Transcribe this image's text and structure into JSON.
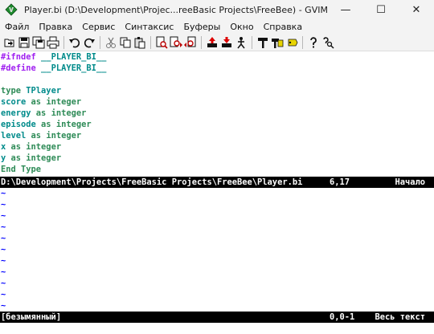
{
  "window": {
    "title": "Player.bi (D:\\Development\\Projec...reeBasic Projects\\FreeBee) - GVIM",
    "controls": {
      "minimize": "—",
      "maximize": "☐",
      "close": "✕"
    }
  },
  "menu": [
    "Файл",
    "Правка",
    "Сервис",
    "Синтаксис",
    "Буферы",
    "Окно",
    "Справка"
  ],
  "toolbar": {
    "icons": [
      "open-file-icon",
      "save-icon",
      "save-all-icon",
      "print-icon",
      "undo-icon",
      "redo-icon",
      "cut-icon",
      "copy-icon",
      "paste-icon",
      "find-replace-icon",
      "find-next-icon",
      "find-prev-icon",
      "load-session-icon",
      "save-session-icon",
      "run-script-icon",
      "make-icon",
      "run-ctags-icon",
      "jump-to-tag-icon",
      "help-icon",
      "find-help-icon"
    ]
  },
  "editor": {
    "lines": [
      [
        {
          "t": "#ifndef",
          "c": "pre"
        },
        {
          "t": " __PLAYER_BI__",
          "c": "ident"
        }
      ],
      [
        {
          "t": "#define",
          "c": "pre"
        },
        {
          "t": " __PLAYER_BI__",
          "c": "ident"
        }
      ],
      [],
      [
        {
          "t": "type",
          "c": "kw"
        },
        {
          "t": " TPlayer",
          "c": "plain"
        }
      ],
      [
        {
          "t": "score ",
          "c": "plain"
        },
        {
          "t": "as",
          "c": "kw"
        },
        {
          "t": " integer",
          "c": "type"
        }
      ],
      [
        {
          "t": "energy ",
          "c": "plain"
        },
        {
          "t": "as",
          "c": "kw"
        },
        {
          "t": " integer",
          "c": "type"
        }
      ],
      [
        {
          "t": "episode ",
          "c": "plain"
        },
        {
          "t": "as",
          "c": "kw"
        },
        {
          "t": " integer",
          "c": "type"
        }
      ],
      [
        {
          "t": "level ",
          "c": "plain"
        },
        {
          "t": "as",
          "c": "kw"
        },
        {
          "t": " integer",
          "c": "type"
        }
      ],
      [
        {
          "t": "x ",
          "c": "plain"
        },
        {
          "t": "as",
          "c": "kw"
        },
        {
          "t": " integer",
          "c": "type"
        }
      ],
      [
        {
          "t": "y ",
          "c": "plain"
        },
        {
          "t": "as",
          "c": "kw"
        },
        {
          "t": " integer",
          "c": "type"
        }
      ],
      [
        {
          "t": "End",
          "c": "kw"
        },
        {
          "t": " Type",
          "c": "kw"
        }
      ]
    ]
  },
  "status_top": {
    "path": "D:\\Development\\Projects\\FreeBasic Projects\\FreeBee\\Player.bi",
    "position": "6,17",
    "scroll": "Начало"
  },
  "tilde_count": 11,
  "tilde_char": "~",
  "status_bottom": {
    "name": "[безымянный]",
    "position": "0,0-1",
    "scroll": "Весь текст"
  }
}
